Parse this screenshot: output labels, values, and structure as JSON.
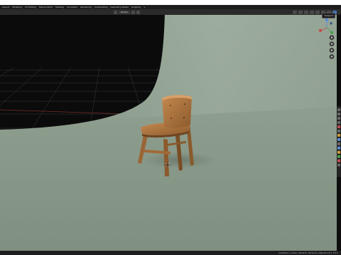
{
  "workspace_tabs": [
    "Layout",
    "Modeling",
    "UV Editing",
    "Texture Paint",
    "Shading",
    "Animation",
    "Rendering",
    "Compositing",
    "Geometry Nodes",
    "Scripting",
    "+"
  ],
  "viewport_header": {
    "pivot_label": "Global"
  },
  "nav_gizmo": {
    "tooltip": "Viewport"
  },
  "status_bar": {
    "text": "Collection | Cube | Verts:8 | Faces:6 | Objects:1/3 | 3.6.0"
  },
  "colors": {
    "accent": "#4772b3",
    "floor": "#8a9a8a",
    "void": "#0b0b0b"
  }
}
